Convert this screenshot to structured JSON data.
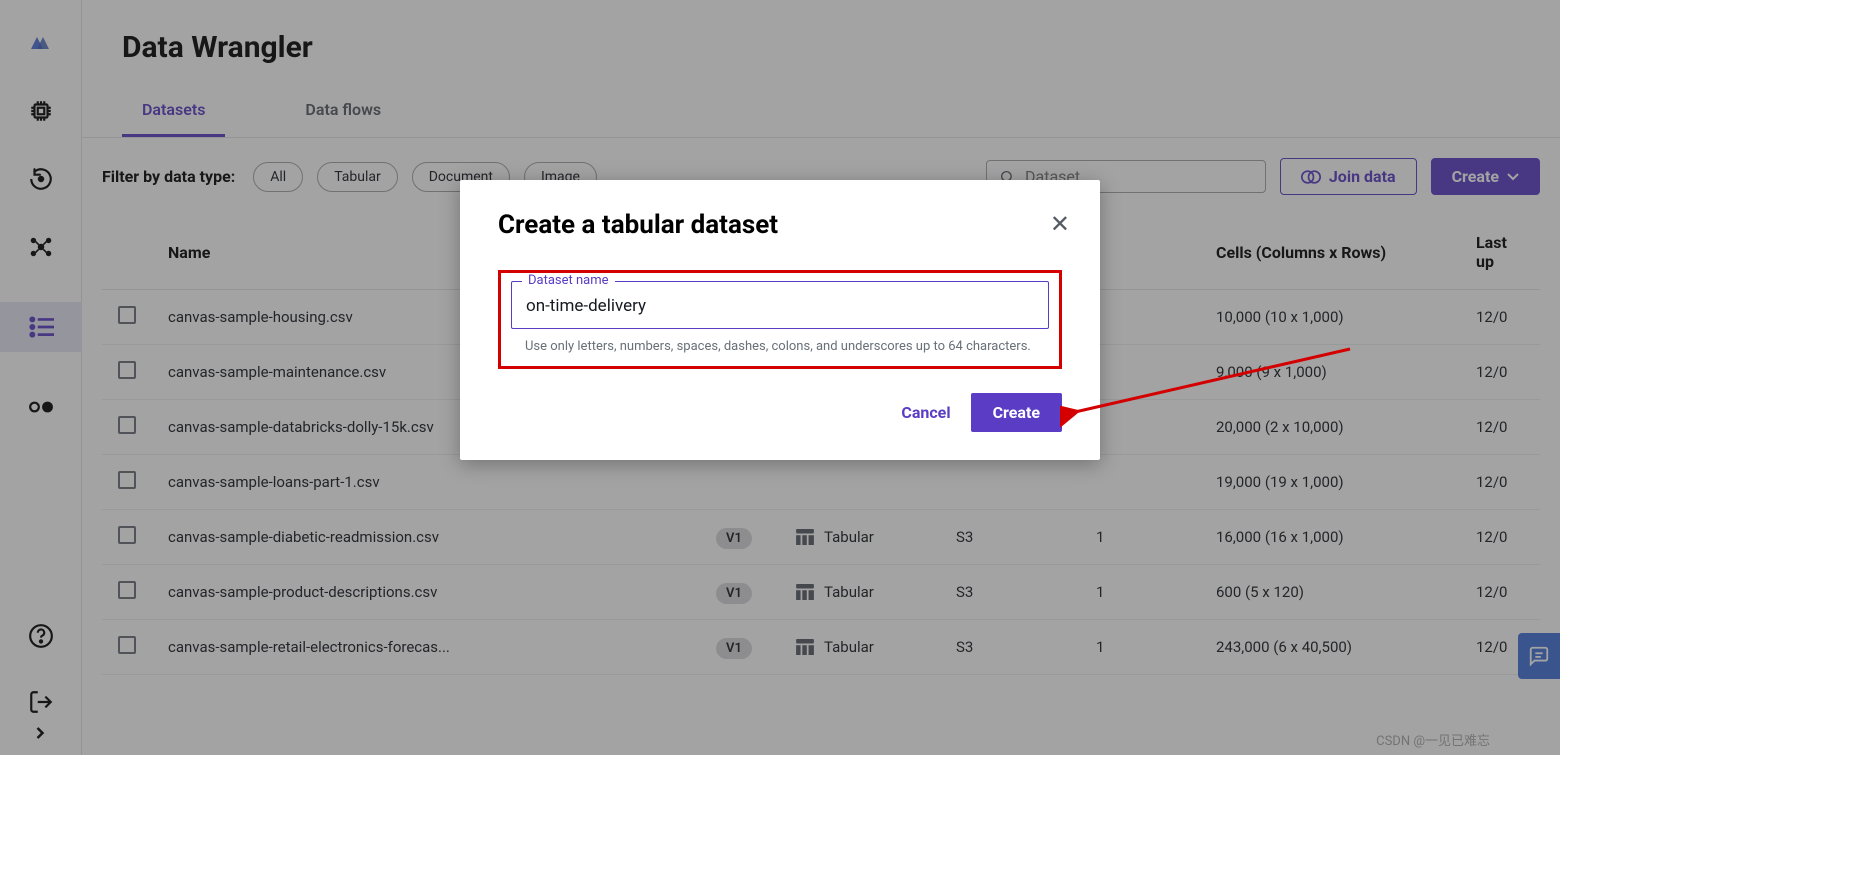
{
  "page": {
    "title": "Data Wrangler"
  },
  "tabs": {
    "datasets": "Datasets",
    "flows": "Data flows"
  },
  "filter": {
    "label": "Filter by data type:",
    "all": "All",
    "tabular": "Tabular",
    "document": "Document",
    "image": "Image"
  },
  "search": {
    "placeholder": "Dataset"
  },
  "buttons": {
    "join": "Join data",
    "create": "Create"
  },
  "columns": {
    "name": "Name",
    "cells": "Cells (Columns x Rows)",
    "updated": "Last up"
  },
  "rows": [
    {
      "name": "canvas-sample-housing.csv",
      "ver": "",
      "type": "",
      "source": "",
      "files": "",
      "cells": "10,000 (10 x 1,000)",
      "updated": "12/0"
    },
    {
      "name": "canvas-sample-maintenance.csv",
      "ver": "",
      "type": "",
      "source": "",
      "files": "",
      "cells": "9,000 (9 x 1,000)",
      "updated": "12/0"
    },
    {
      "name": "canvas-sample-databricks-dolly-15k.csv",
      "ver": "",
      "type": "",
      "source": "",
      "files": "",
      "cells": "20,000 (2 x 10,000)",
      "updated": "12/0"
    },
    {
      "name": "canvas-sample-loans-part-1.csv",
      "ver": "",
      "type": "",
      "source": "",
      "files": "",
      "cells": "19,000 (19 x 1,000)",
      "updated": "12/0"
    },
    {
      "name": "canvas-sample-diabetic-readmission.csv",
      "ver": "V1",
      "type": "Tabular",
      "source": "S3",
      "files": "1",
      "cells": "16,000 (16 x 1,000)",
      "updated": "12/0"
    },
    {
      "name": "canvas-sample-product-descriptions.csv",
      "ver": "V1",
      "type": "Tabular",
      "source": "S3",
      "files": "1",
      "cells": "600 (5 x 120)",
      "updated": "12/0"
    },
    {
      "name": "canvas-sample-retail-electronics-forecas...",
      "ver": "V1",
      "type": "Tabular",
      "source": "S3",
      "files": "1",
      "cells": "243,000 (6 x 40,500)",
      "updated": "12/0"
    }
  ],
  "modal": {
    "title": "Create a tabular dataset",
    "input_label": "Dataset name",
    "value": "on-time-delivery",
    "hint": "Use only letters, numbers, spaces, dashes, colons, and underscores up to 64 characters.",
    "cancel": "Cancel",
    "create": "Create"
  },
  "watermark": "CSDN @一见已难忘"
}
